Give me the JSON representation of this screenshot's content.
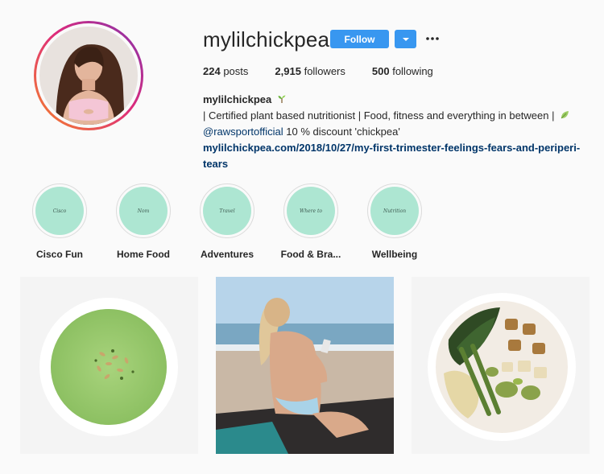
{
  "profile": {
    "username": "mylilchickpea",
    "follow_label": "Follow",
    "stats": {
      "posts_count": "224",
      "posts_label": "posts",
      "followers_count": "2,915",
      "followers_label": "followers",
      "following_count": "500",
      "following_label": "following"
    },
    "bio": {
      "name": "mylilchickpea",
      "line1": "| Certified plant based nutritionist | Food, fitness and everything in between |",
      "mention": "@rawsportofficial",
      "line2_rest": " 10 % discount 'chickpea'",
      "link": "mylilchickpea.com/2018/10/27/my-first-trimester-feelings-fears-and-periperi-tears"
    }
  },
  "highlights": [
    {
      "label": "Cisco Fun",
      "cover_text": "Cisco"
    },
    {
      "label": "Home Food",
      "cover_text": "Nom"
    },
    {
      "label": "Adventures",
      "cover_text": "Travel"
    },
    {
      "label": "Food & Bra...",
      "cover_text": "Where to"
    },
    {
      "label": "Wellbeing",
      "cover_text": "Nutrition"
    }
  ],
  "posts": [
    {
      "subject": "green soup bowl"
    },
    {
      "subject": "woman on beach"
    },
    {
      "subject": "vegetable bowl"
    }
  ],
  "colors": {
    "accent": "#3897f0",
    "highlight_cover": "#ade6d2",
    "link": "#003569"
  },
  "icons": {
    "verified_sprout": "sprout-icon",
    "leaf": "leaf-icon",
    "more": "more-options-icon",
    "dropdown": "chevron-down-icon"
  }
}
